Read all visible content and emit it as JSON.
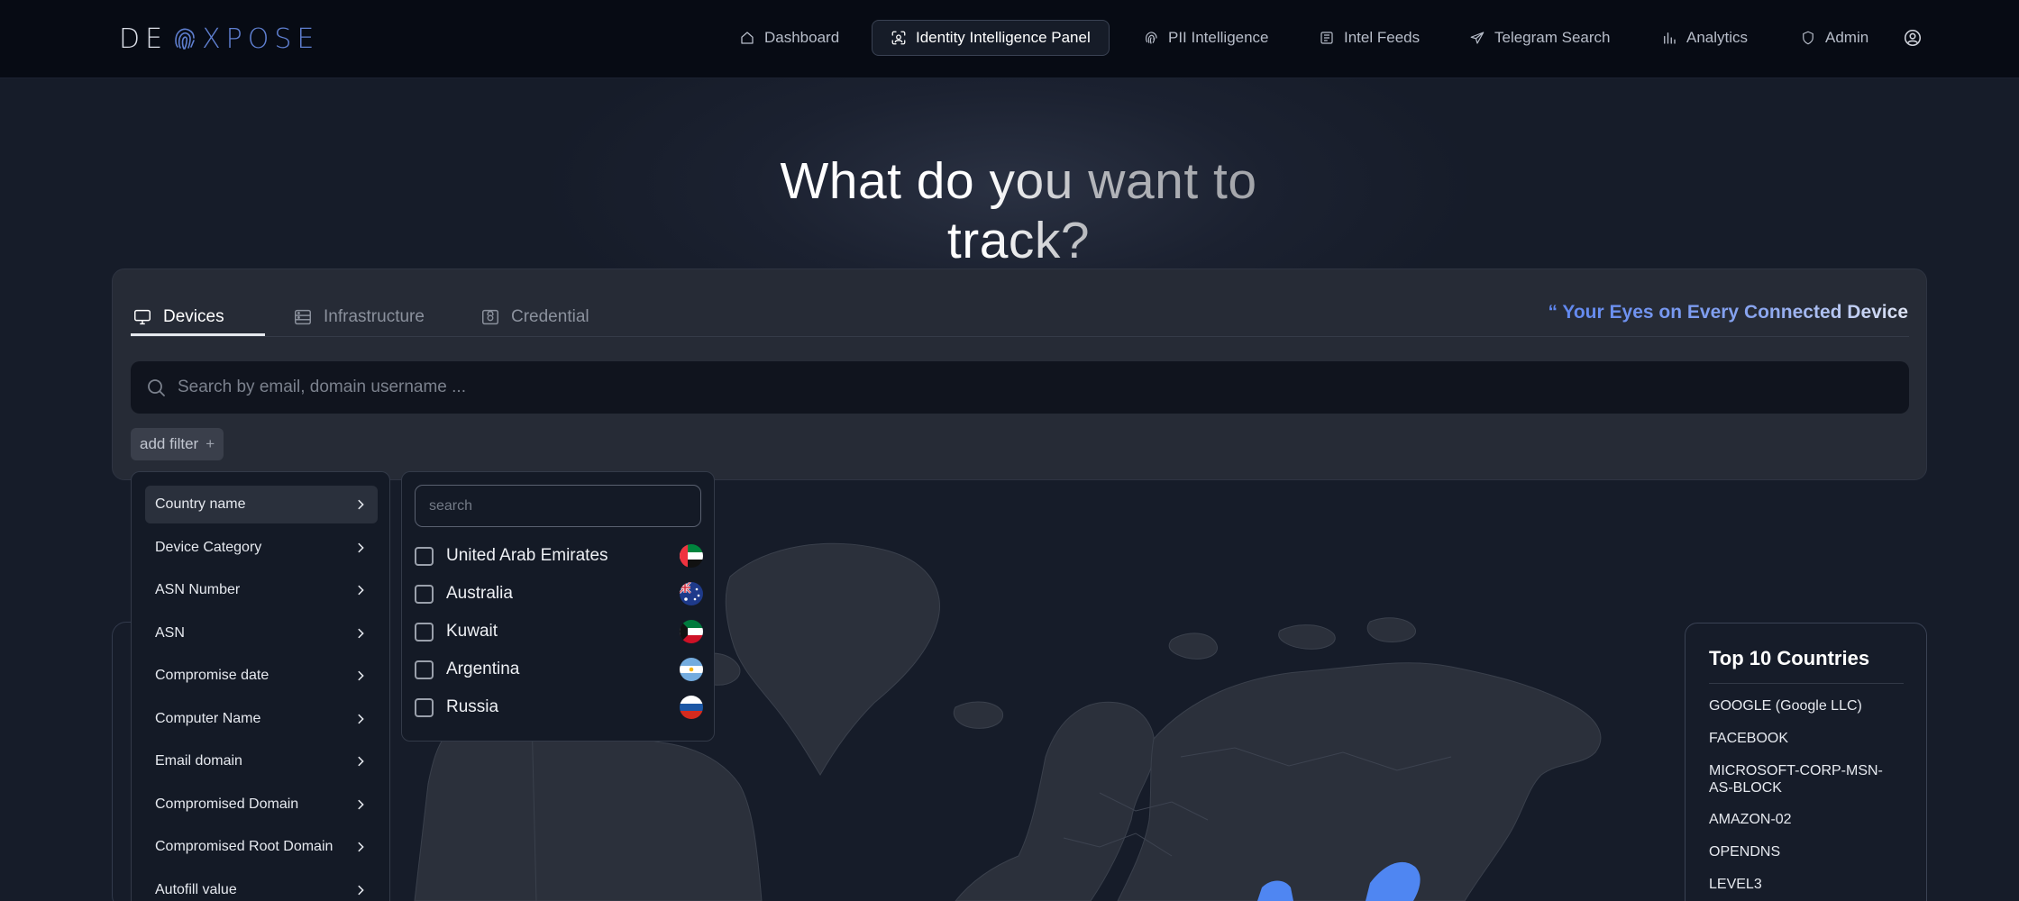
{
  "brand": {
    "logo_left": "DE",
    "logo_right": "XPOSE"
  },
  "nav": {
    "items": [
      {
        "label": "Dashboard",
        "icon": "home-icon"
      },
      {
        "label": "Identity Intelligence Panel",
        "icon": "face-scan-icon",
        "active": true
      },
      {
        "label": "PII Intelligence",
        "icon": "fingerprint-icon"
      },
      {
        "label": "Intel Feeds",
        "icon": "newspaper-icon"
      },
      {
        "label": "Telegram Search",
        "icon": "send-icon"
      },
      {
        "label": "Analytics",
        "icon": "bar-chart-icon"
      },
      {
        "label": "Admin",
        "icon": "shield-icon"
      }
    ],
    "account_icon": "user-circle-icon"
  },
  "hero": {
    "headline": "What do you want to track?"
  },
  "search_panel": {
    "tabs": [
      {
        "label": "Devices",
        "icon": "monitor-icon",
        "active": true
      },
      {
        "label": "Infrastructure",
        "icon": "server-icon"
      },
      {
        "label": "Credential",
        "icon": "lock-icon"
      }
    ],
    "tagline": "“ Your Eyes on Every Connected Device",
    "search_placeholder": "Search by email, domain username ...",
    "add_filter_label": "add filter",
    "add_filter_symbol": "+"
  },
  "filter_menu": {
    "items": [
      "Country name",
      "Device Category",
      "ASN Number",
      "ASN",
      "Compromise date",
      "Computer Name",
      "Email domain",
      "Compromised Domain",
      "Compromised Root Domain",
      "Autofill value"
    ],
    "active_index": 0
  },
  "country_filter": {
    "search_placeholder": "search",
    "options": [
      {
        "name": "United Arab Emirates",
        "flag": "uae-flag-icon",
        "checked": false
      },
      {
        "name": "Australia",
        "flag": "australia-flag-icon",
        "checked": false
      },
      {
        "name": "Kuwait",
        "flag": "kuwait-flag-icon",
        "checked": false
      },
      {
        "name": "Argentina",
        "flag": "argentina-flag-icon",
        "checked": false
      },
      {
        "name": "Russia",
        "flag": "russia-flag-icon",
        "checked": false
      }
    ]
  },
  "top_countries": {
    "title": "Top 10 Countries",
    "items": [
      "GOOGLE (Google LLC)",
      "FACEBOOK",
      "MICROSOFT-CORP-MSN-AS-BLOCK",
      "AMAZON-02",
      "OPENDNS",
      "LEVEL3"
    ]
  },
  "colors": {
    "background": "#161c29",
    "topbar": "#070b14",
    "accent_blue": "#5e86f0",
    "map_land": "#2b303b",
    "map_highlight": "#4f86f2"
  }
}
